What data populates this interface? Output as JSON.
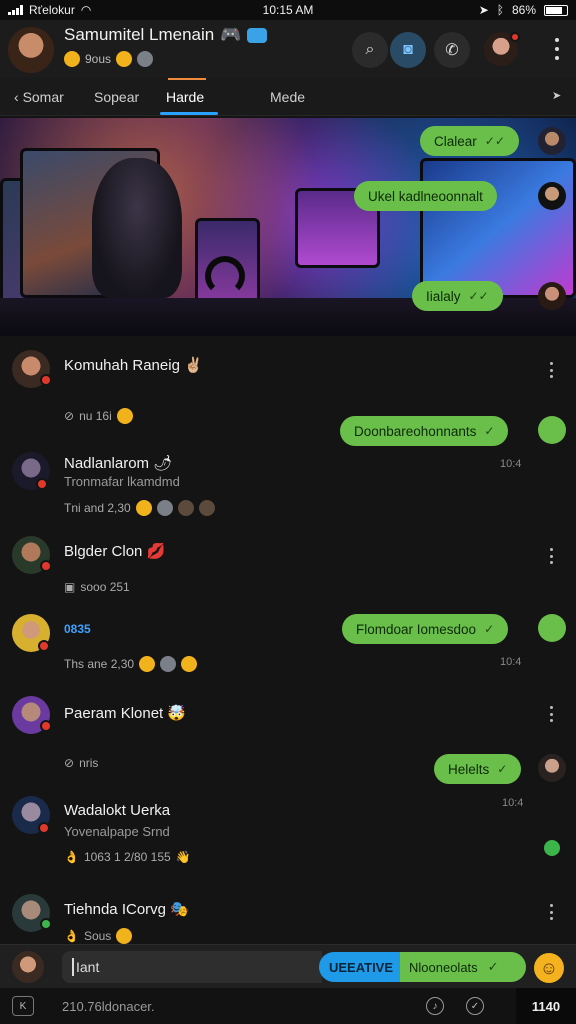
{
  "status": {
    "carrier": "Rťelokur",
    "time": "10:15 AM",
    "battery": "86%"
  },
  "header": {
    "title": "Samumitel Lmenain",
    "title_emoji": "🎮",
    "subtitle": "9ous",
    "actions": [
      "search-icon",
      "camera-icon",
      "call-icon"
    ]
  },
  "tabs": [
    "Somar",
    "Sopear",
    "Harde",
    "Mede"
  ],
  "banner_bubbles": [
    "Clalear",
    "Ukel kadlneoonnalt",
    "Iialaly"
  ],
  "chats": [
    {
      "name": "Komuhah Raneig",
      "emoji": "✌🏼",
      "meta": "nu 16i"
    },
    {
      "name": "Nadlanlarom",
      "emoji": "🌶",
      "sub": "Tronmafar lkamdmd",
      "meta": "Tni and 2,30"
    },
    {
      "name": "Blgder Clon",
      "emoji": "💋",
      "meta": "sooo 251"
    },
    {
      "name": "0835",
      "meta": "Ths ane 2,30"
    },
    {
      "name": "Paeram Klonet",
      "emoji": "🤯",
      "meta": "nris"
    },
    {
      "name": "Wadalokt Uerka",
      "sub": "Yovenalpape Srnd",
      "meta": "1063 1 2/80 155"
    },
    {
      "name": "Tiehnda ICorvg",
      "emoji": "🎭",
      "meta": "Sous"
    }
  ],
  "outgoing": [
    {
      "text": "Doonbareohonnants",
      "time": "10:4"
    },
    {
      "text": "Flomdoar Iomesdoo",
      "time": "10:4"
    },
    {
      "text": "Helelts",
      "time": "10:4"
    }
  ],
  "composer": {
    "placeholder": "Iant",
    "send_label": "UEEATIVE",
    "suggest": "Nlooneolats"
  },
  "bottom": {
    "text": "210.76ldonacer.",
    "right": "1140"
  },
  "colors": {
    "bubble": "#6abf4b",
    "accent": "#1e9ae8",
    "background": "#141414"
  }
}
